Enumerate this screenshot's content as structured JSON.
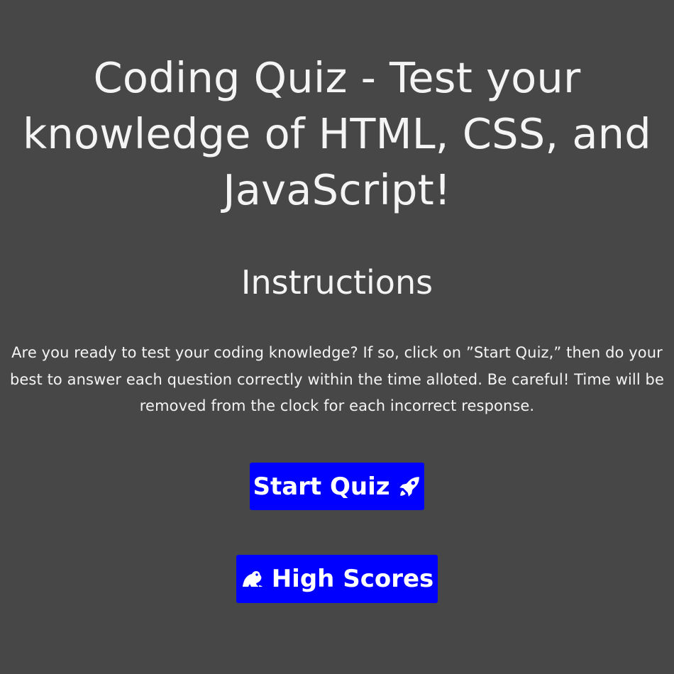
{
  "page": {
    "title": "Coding Quiz - Test your knowledge of HTML, CSS, and JavaScript!",
    "instructions_heading": "Instructions",
    "instructions_text": "Are you ready to test your coding knowledge? If so, click on ”Start Quiz,” then do your best to answer each question correctly within the time alloted. Be careful! Time will be removed from the clock for each incorrect response."
  },
  "buttons": {
    "start_quiz": {
      "label": "Start Quiz",
      "icon": "rocket-icon"
    },
    "high_scores": {
      "label": "High Scores",
      "icon": "frog-icon"
    }
  },
  "colors": {
    "background": "#474747",
    "text": "#f4f4f4",
    "button_bg": "#0000ff",
    "button_text": "#ffffff"
  }
}
